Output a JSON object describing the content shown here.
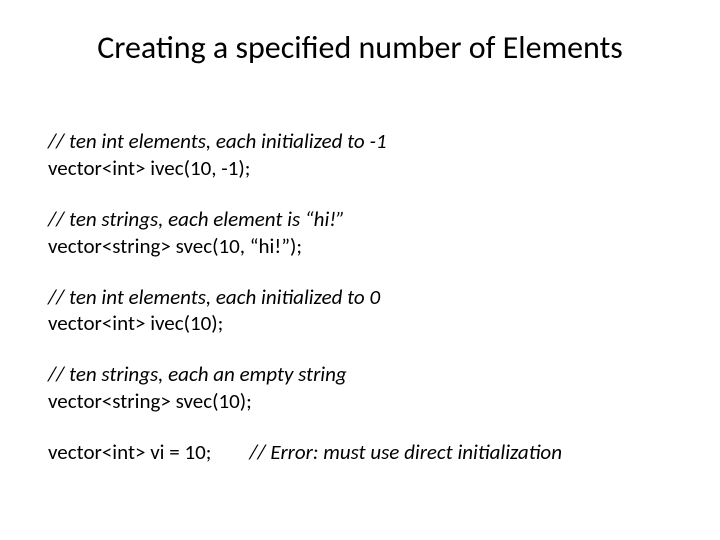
{
  "title": "Creating a specified number of Elements",
  "blocks": {
    "b1": {
      "comment": "// ten int elements, each initialized to -1",
      "code": "vector<int> ivec(10, -1);"
    },
    "b2": {
      "comment": "// ten strings, each element is “hi!”",
      "code": "vector<string> svec(10, “hi!”);"
    },
    "b3": {
      "comment": "// ten int elements, each initialized to 0",
      "code": "vector<int> ivec(10);"
    },
    "b4": {
      "comment": "// ten strings, each an empty string",
      "code": "vector<string> svec(10);"
    },
    "b5": {
      "code": "vector<int> vi = 10;",
      "comment": "// Error: must use direct initialization"
    }
  }
}
